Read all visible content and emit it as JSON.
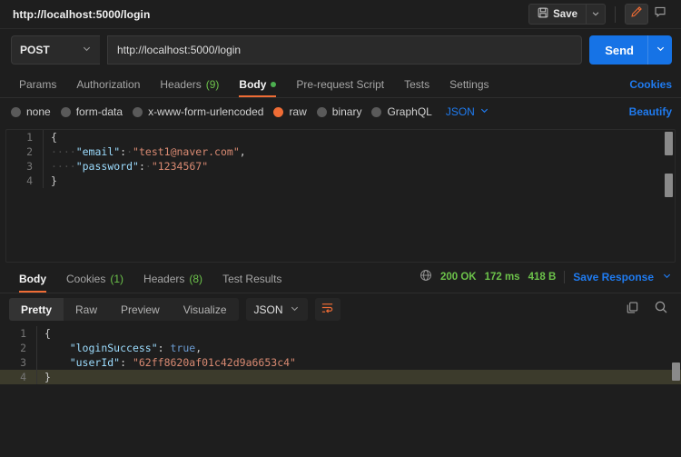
{
  "topbar": {
    "request_title": "http://localhost:5000/login",
    "save_label": "Save",
    "save_icon": "floppy-disk-icon",
    "save_caret_icon": "chevron-down-icon",
    "edit_icon": "pencil-icon",
    "comment_icon": "comment-icon",
    "accent_orange": "#ef6c35"
  },
  "url_bar": {
    "method": "POST",
    "method_caret_icon": "chevron-down-icon",
    "url": "http://localhost:5000/login",
    "send_label": "Send",
    "send_caret_icon": "chevron-down-icon",
    "send_color": "#1673e6"
  },
  "request_tabs": {
    "items": [
      {
        "label": "Params",
        "count": "",
        "active": false,
        "dot": false
      },
      {
        "label": "Authorization",
        "count": "",
        "active": false,
        "dot": false
      },
      {
        "label": "Headers",
        "count": "(9)",
        "active": false,
        "dot": false
      },
      {
        "label": "Body",
        "count": "",
        "active": true,
        "dot": true
      },
      {
        "label": "Pre-request Script",
        "count": "",
        "active": false,
        "dot": false
      },
      {
        "label": "Tests",
        "count": "",
        "active": false,
        "dot": false
      },
      {
        "label": "Settings",
        "count": "",
        "active": false,
        "dot": false
      }
    ],
    "cookies_link": "Cookies"
  },
  "body_type": {
    "options": [
      {
        "label": "none",
        "selected": false
      },
      {
        "label": "form-data",
        "selected": false
      },
      {
        "label": "x-www-form-urlencoded",
        "selected": false
      },
      {
        "label": "raw",
        "selected": true
      },
      {
        "label": "binary",
        "selected": false
      },
      {
        "label": "GraphQL",
        "selected": false
      }
    ],
    "language": "JSON",
    "language_caret_icon": "chevron-down-icon",
    "beautify_link": "Beautify"
  },
  "request_body": {
    "lines": [
      {
        "n": "1",
        "tokens": [
          {
            "t": "{",
            "c": "brace"
          }
        ]
      },
      {
        "n": "2",
        "tokens": [
          {
            "t": "····",
            "c": "ws"
          },
          {
            "t": "\"email\"",
            "c": "key"
          },
          {
            "t": ":",
            "c": "punc"
          },
          {
            "t": "·",
            "c": "ws"
          },
          {
            "t": "\"test1@naver.com\"",
            "c": "str"
          },
          {
            "t": ",",
            "c": "punc"
          }
        ]
      },
      {
        "n": "3",
        "tokens": [
          {
            "t": "····",
            "c": "ws"
          },
          {
            "t": "\"password\"",
            "c": "key"
          },
          {
            "t": ":",
            "c": "punc"
          },
          {
            "t": "·",
            "c": "ws"
          },
          {
            "t": "\"1234567\"",
            "c": "str"
          }
        ]
      },
      {
        "n": "4",
        "tokens": [
          {
            "t": "}",
            "c": "brace"
          }
        ]
      }
    ]
  },
  "response_tabs": {
    "items": [
      {
        "label": "Body",
        "count": "",
        "active": true
      },
      {
        "label": "Cookies",
        "count": "(1)",
        "active": false
      },
      {
        "label": "Headers",
        "count": "(8)",
        "active": false
      },
      {
        "label": "Test Results",
        "count": "",
        "active": false
      }
    ],
    "globe_icon": "globe-icon",
    "status": "200 OK",
    "time": "172 ms",
    "size": "418 B",
    "save_response_label": "Save Response",
    "save_response_caret_icon": "chevron-down-icon"
  },
  "response_controls": {
    "views": [
      {
        "label": "Pretty",
        "active": true
      },
      {
        "label": "Raw",
        "active": false
      },
      {
        "label": "Preview",
        "active": false
      },
      {
        "label": "Visualize",
        "active": false
      }
    ],
    "language": "JSON",
    "language_caret_icon": "chevron-down-icon",
    "wrap_icon": "word-wrap-icon",
    "copy_icon": "copy-icon",
    "search_icon": "search-icon"
  },
  "response_body": {
    "lines": [
      {
        "n": "1",
        "highlight": false,
        "tokens": [
          {
            "t": "{",
            "c": "brace"
          }
        ]
      },
      {
        "n": "2",
        "highlight": false,
        "tokens": [
          {
            "t": "    ",
            "c": "ws"
          },
          {
            "t": "\"loginSuccess\"",
            "c": "key"
          },
          {
            "t": ": ",
            "c": "punc"
          },
          {
            "t": "true",
            "c": "bool"
          },
          {
            "t": ",",
            "c": "punc"
          }
        ]
      },
      {
        "n": "3",
        "highlight": false,
        "tokens": [
          {
            "t": "    ",
            "c": "ws"
          },
          {
            "t": "\"userId\"",
            "c": "key"
          },
          {
            "t": ": ",
            "c": "punc"
          },
          {
            "t": "\"62ff8620af01c42d9a6653c4\"",
            "c": "str"
          }
        ]
      },
      {
        "n": "4",
        "highlight": true,
        "tokens": [
          {
            "t": "}",
            "c": "brace"
          }
        ]
      }
    ]
  }
}
